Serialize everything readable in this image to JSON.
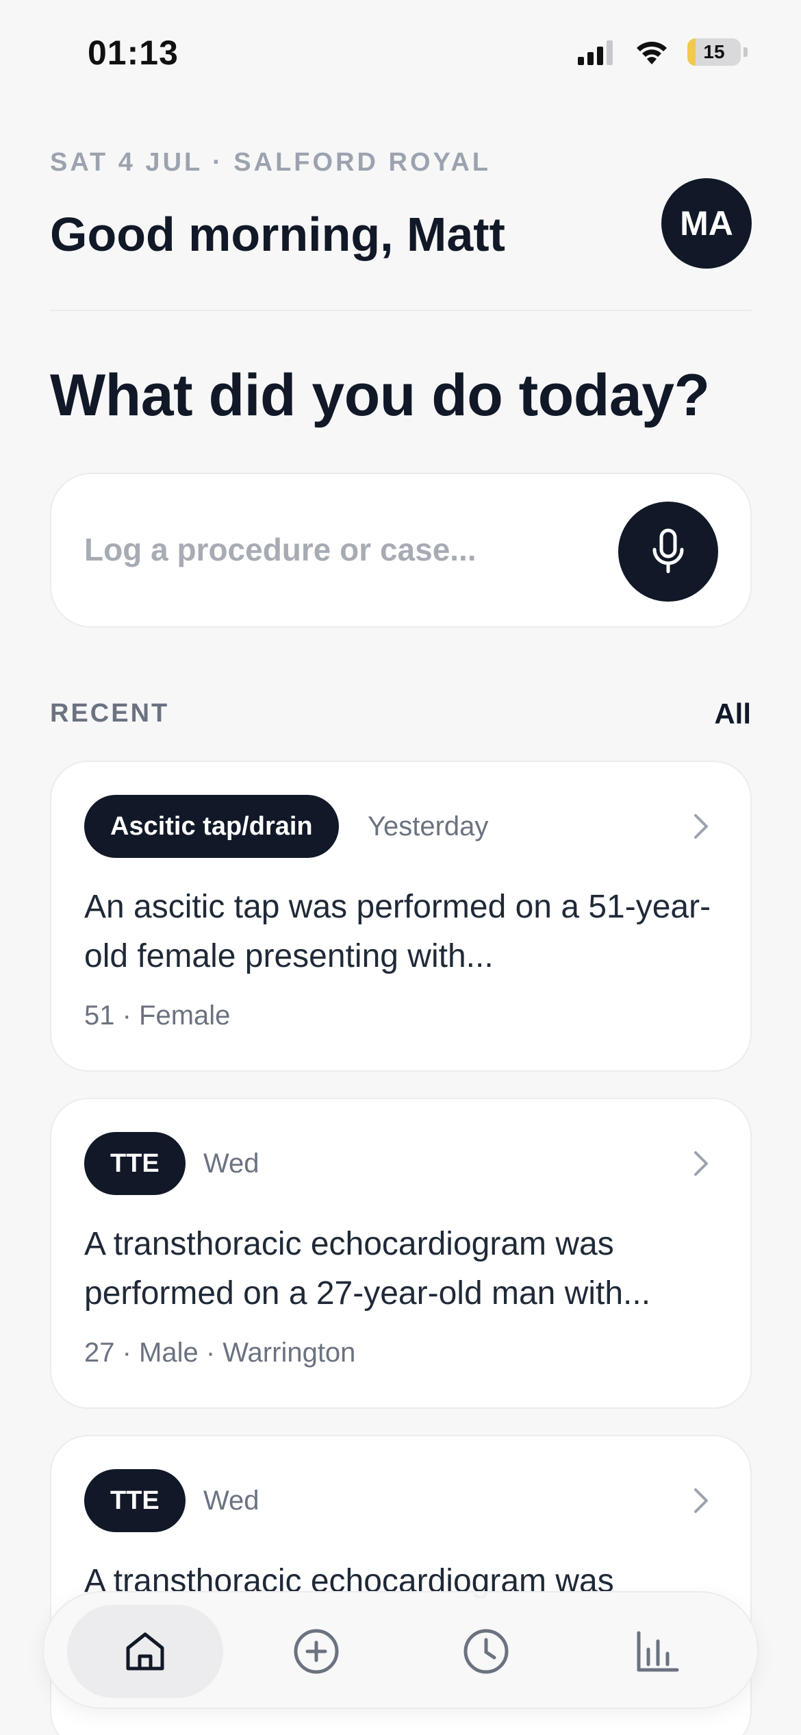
{
  "status_bar": {
    "time": "01:13",
    "battery": "15",
    "battery_level": 0.15
  },
  "header": {
    "subtitle": "SAT 4 JUL · SALFORD ROYAL",
    "greeting": "Good morning, Matt",
    "avatar_initials": "MA"
  },
  "prompt": {
    "question": "What did you do today?",
    "placeholder": "Log a procedure or case...",
    "mic_icon": "microphone-icon"
  },
  "recent": {
    "label": "RECENT",
    "all_label": "All",
    "items": [
      {
        "tag": "Ascitic tap/drain",
        "when": "Yesterday",
        "description": "An ascitic tap was performed on a 51-year-old female presenting with...",
        "meta": "51 · Female"
      },
      {
        "tag": "TTE",
        "when": "Wed",
        "description": "A transthoracic echocardiogram was performed on a 27-year-old man with...",
        "meta": "27 · Male · Warrington"
      },
      {
        "tag": "TTE",
        "when": "Wed",
        "description": "A transthoracic echocardiogram was",
        "meta": ""
      }
    ]
  },
  "nav": {
    "items": [
      {
        "icon": "home-icon",
        "active": true
      },
      {
        "icon": "plus-circle-icon",
        "active": false
      },
      {
        "icon": "clock-icon",
        "active": false
      },
      {
        "icon": "bar-chart-icon",
        "active": false
      }
    ]
  },
  "colors": {
    "accent": "#111827",
    "background": "#f7f7f8",
    "muted": "#6b7280",
    "battery": "#f2c94c"
  }
}
